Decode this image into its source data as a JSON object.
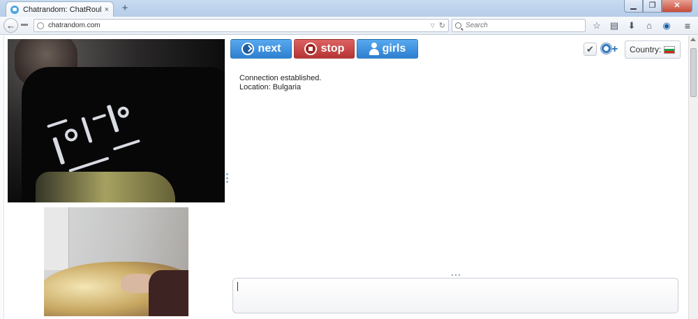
{
  "browser": {
    "tab_title": "Chatrandom: ChatRoulette...",
    "tab_close": "×",
    "new_tab": "+",
    "window_buttons": {
      "minimize": "▁",
      "maximize": "❐",
      "close": "✕"
    },
    "back": "←",
    "url": "chatrandom.com",
    "search_placeholder": "Search",
    "toolbar_icons": [
      "star-icon",
      "reading-list-icon",
      "download-icon",
      "home-icon",
      "extension-icon"
    ],
    "toolbar_glyphs": {
      "star": "☆",
      "reading": "▤",
      "download": "⬇",
      "home": "⌂",
      "extension": "◉"
    },
    "menu": "≡"
  },
  "controls": {
    "next_label": "next",
    "stop_label": "stop",
    "girls_label": "girls",
    "check": "✔",
    "webcam_plus": "+",
    "country_label": "Country:",
    "country_flag": "Bulgaria"
  },
  "chat": {
    "lines": [
      "Connection established.",
      "Location: Bulgaria"
    ],
    "input_value": ""
  },
  "colors": {
    "next": "#3d92e0",
    "stop": "#c94848",
    "girls": "#3d92e0"
  }
}
